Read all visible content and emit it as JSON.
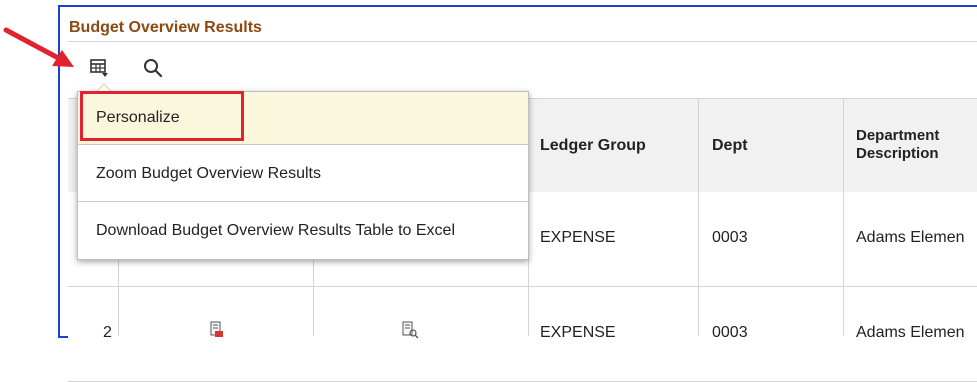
{
  "panel": {
    "title": "Budget Overview Results"
  },
  "toolbar": {
    "grid_icon": "grid-menu-icon",
    "search_icon": "search-icon"
  },
  "menu": {
    "items": [
      "Personalize",
      "Zoom Budget Overview Results",
      "Download Budget Overview Results Table to Excel"
    ]
  },
  "table": {
    "headers": {
      "ledger_group": "Ledger Group",
      "dept": "Dept",
      "dept_desc_1": "Department",
      "dept_desc_2": "Description"
    },
    "rows": [
      {
        "num": "",
        "ledger_group": "EXPENSE",
        "dept": "0003",
        "dept_desc": "Adams Elemen"
      },
      {
        "num": "2",
        "ledger_group": "EXPENSE",
        "dept": "0003",
        "dept_desc": "Adams Elemen"
      }
    ]
  },
  "colors": {
    "title": "#8a4a12",
    "frame": "#1f3fd1",
    "callout": "#e0232e",
    "menu_hover": "#fbf7dc"
  }
}
